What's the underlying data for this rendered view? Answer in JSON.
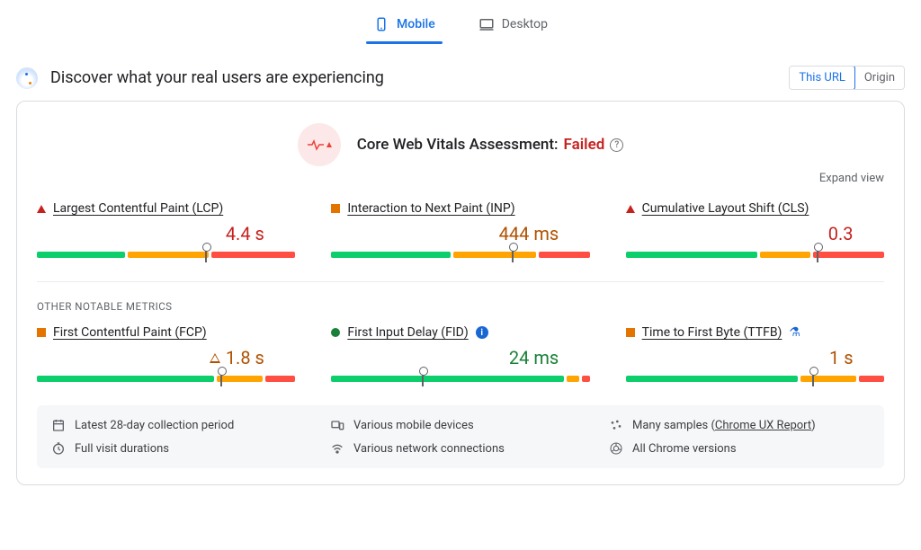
{
  "tabs": {
    "mobile": "Mobile",
    "desktop": "Desktop",
    "active": "mobile"
  },
  "header": {
    "title": "Discover what your real users are experiencing",
    "toggle": {
      "this_url": "This URL",
      "origin": "Origin"
    }
  },
  "assessment": {
    "label": "Core Web Vitals Assessment:",
    "result": "Failed"
  },
  "expand_view": "Expand view",
  "core_metrics": [
    {
      "name": "Largest Contentful Paint (LCP)",
      "value": "4.4 s",
      "status": "red",
      "indicator": "triangle-red",
      "bar": {
        "g": 35,
        "a": 32,
        "r": 33,
        "marker": 65
      }
    },
    {
      "name": "Interaction to Next Paint (INP)",
      "value": "444 ms",
      "status": "amber",
      "indicator": "square-amber",
      "bar": {
        "g": 47,
        "a": 33,
        "r": 20,
        "marker": 70
      }
    },
    {
      "name": "Cumulative Layout Shift (CLS)",
      "value": "0.3",
      "status": "red",
      "indicator": "triangle-red",
      "bar": {
        "g": 52,
        "a": 20,
        "r": 28,
        "marker": 74
      }
    }
  ],
  "other_label": "OTHER NOTABLE METRICS",
  "other_metrics": [
    {
      "name": "First Contentful Paint (FCP)",
      "value": "1.8 s",
      "status": "amber",
      "indicator": "square-amber",
      "warn_icon": true,
      "bar": {
        "g": 70,
        "a": 18,
        "r": 12,
        "marker": 71
      }
    },
    {
      "name": "First Input Delay (FID)",
      "value": "24 ms",
      "status": "green",
      "indicator": "circle-green",
      "info": true,
      "bar": {
        "g": 92,
        "a": 5,
        "r": 3,
        "marker": 35
      }
    },
    {
      "name": "Time to First Byte (TTFB)",
      "value": "1 s",
      "status": "amber",
      "indicator": "square-amber",
      "flask": true,
      "bar": {
        "g": 68,
        "a": 22,
        "r": 10,
        "marker": 72
      }
    }
  ],
  "footer": {
    "period": "Latest 28-day collection period",
    "devices": "Various mobile devices",
    "samples": "Many samples",
    "samples_link": "Chrome UX Report",
    "durations": "Full visit durations",
    "network": "Various network connections",
    "chrome": "All Chrome versions"
  }
}
